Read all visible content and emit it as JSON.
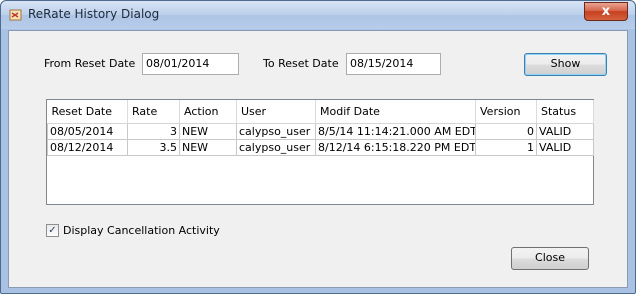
{
  "window": {
    "title": "ReRate History Dialog",
    "close_glyph": "x"
  },
  "filters": {
    "from_label": "From Reset Date",
    "from_value": "08/01/2014",
    "to_label": "To Reset Date",
    "to_value": "08/15/2014",
    "show_label": "Show"
  },
  "table": {
    "columns": [
      "Reset Date",
      "Rate",
      "Action",
      "User",
      "Modif Date",
      "Version",
      "Status"
    ],
    "rows": [
      [
        "08/05/2014",
        "3",
        "NEW",
        "calypso_user",
        "8/5/14 11:14:21.000 AM EDT",
        "0",
        "VALID"
      ],
      [
        "08/12/2014",
        "3.5",
        "NEW",
        "calypso_user",
        "8/12/14 6:15:18.220 PM EDT",
        "1",
        "VALID"
      ]
    ]
  },
  "options": {
    "cancellation_label": "Display Cancellation Activity",
    "cancellation_checked": true,
    "check_glyph": "✓"
  },
  "footer": {
    "close_label": "Close"
  }
}
